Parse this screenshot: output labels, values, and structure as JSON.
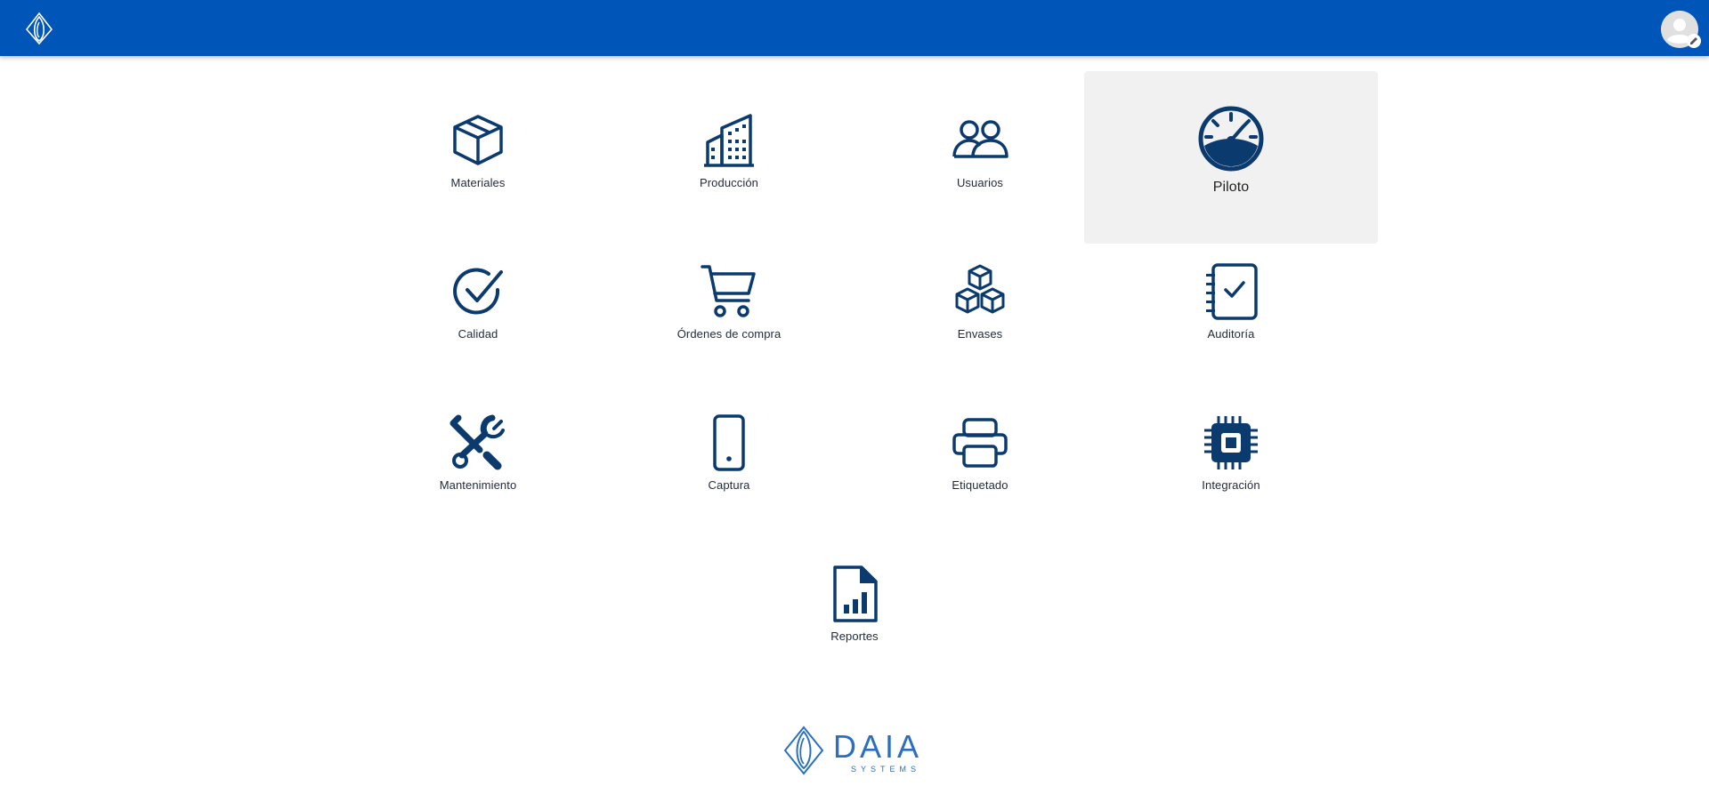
{
  "header": {
    "logo_icon": "daia-drop-logo-icon",
    "user_avatar_icon": "user-avatar-icon",
    "edit_icon": "pencil-icon",
    "bg_color": "#0055b8"
  },
  "modules": [
    {
      "label": "Materiales",
      "icon": "box-icon"
    },
    {
      "label": "Producción",
      "icon": "building-icon"
    },
    {
      "label": "Usuarios",
      "icon": "users-icon"
    },
    {
      "label": "Piloto",
      "icon": "speedometer-icon",
      "selected": true
    },
    {
      "label": "Calidad",
      "icon": "check-circle-icon"
    },
    {
      "label": "Órdenes de compra",
      "icon": "shopping-cart-icon"
    },
    {
      "label": "Envases",
      "icon": "boxes-icon"
    },
    {
      "label": "Auditoría",
      "icon": "checklist-icon"
    },
    {
      "label": "Mantenimiento",
      "icon": "tools-icon"
    },
    {
      "label": "Captura",
      "icon": "mobile-phone-icon"
    },
    {
      "label": "Etiquetado",
      "icon": "printer-icon"
    },
    {
      "label": "Integración",
      "icon": "cpu-chip-icon"
    },
    {
      "label": "Reportes",
      "icon": "report-file-icon"
    }
  ],
  "footer": {
    "brand": "DAIA",
    "subtitle": "SYSTEMS",
    "logo_color": "#2a6fc0"
  },
  "icon_color": "#0b3a6f"
}
